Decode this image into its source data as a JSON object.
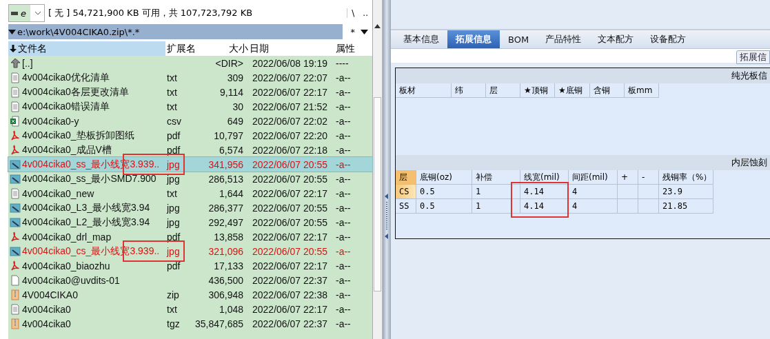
{
  "file_panel": {
    "drive": {
      "letter": "e"
    },
    "free_space": "[ 无 ]  54,721,900 KB 可用，共 107,723,792 KB",
    "nav_buttons": [
      "\\",
      ".."
    ],
    "path": "e:\\work\\4V004CIKA0.zip\\*.*",
    "filter": "*",
    "columns": [
      {
        "label": "文件名",
        "sorted": true
      },
      {
        "label": "扩展名",
        "sorted": false
      },
      {
        "label": "大小",
        "sorted": false
      },
      {
        "label": "日期",
        "sorted": false
      },
      {
        "label": "属性",
        "sorted": false
      }
    ],
    "rows": [
      {
        "kind": "up",
        "name": "[..]",
        "ext": "",
        "size": "<DIR>",
        "date": "2022/06/08 19:19",
        "attr": "----",
        "selected": false,
        "marked": false,
        "annotated": false
      },
      {
        "kind": "text",
        "name": "4v004cika0优化清单",
        "ext": "txt",
        "size": "309",
        "date": "2022/06/07 22:07",
        "attr": "-a--",
        "selected": false,
        "marked": false,
        "annotated": false
      },
      {
        "kind": "text",
        "name": "4v004cika0各层更改清单",
        "ext": "txt",
        "size": "9,114",
        "date": "2022/06/07 22:17",
        "attr": "-a--",
        "selected": false,
        "marked": false,
        "annotated": false
      },
      {
        "kind": "text",
        "name": "4v004cika0错误清单",
        "ext": "txt",
        "size": "30",
        "date": "2022/06/07 21:52",
        "attr": "-a--",
        "selected": false,
        "marked": false,
        "annotated": false
      },
      {
        "kind": "sheet",
        "name": "4v004cika0-y",
        "ext": "csv",
        "size": "649",
        "date": "2022/06/07 22:02",
        "attr": "-a--",
        "selected": false,
        "marked": false,
        "annotated": false
      },
      {
        "kind": "pdf",
        "name": "4v004cika0_垫板拆卸图纸",
        "ext": "pdf",
        "size": "10,797",
        "date": "2022/06/07 22:20",
        "attr": "-a--",
        "selected": false,
        "marked": false,
        "annotated": false
      },
      {
        "kind": "pdf",
        "name": "4v004cika0_成品V槽",
        "ext": "pdf",
        "size": "6,574",
        "date": "2022/06/07 22:18",
        "attr": "-a--",
        "selected": false,
        "marked": false,
        "annotated": false
      },
      {
        "kind": "image",
        "name": "4v004cika0_ss_最小线宽3.939..",
        "ext": "jpg",
        "size": "341,956",
        "date": "2022/06/07 20:55",
        "attr": "-a--",
        "selected": true,
        "marked": true,
        "annotated": true
      },
      {
        "kind": "image",
        "name": "4v004cika0_ss_最小SMD7.900",
        "ext": "jpg",
        "size": "286,513",
        "date": "2022/06/07 20:55",
        "attr": "-a--",
        "selected": false,
        "marked": false,
        "annotated": false
      },
      {
        "kind": "text",
        "name": "4v004cika0_new",
        "ext": "txt",
        "size": "1,644",
        "date": "2022/06/07 22:17",
        "attr": "-a--",
        "selected": false,
        "marked": false,
        "annotated": false
      },
      {
        "kind": "image",
        "name": "4v004cika0_L3_最小线宽3.94",
        "ext": "jpg",
        "size": "286,377",
        "date": "2022/06/07 20:55",
        "attr": "-a--",
        "selected": false,
        "marked": false,
        "annotated": false
      },
      {
        "kind": "image",
        "name": "4v004cika0_L2_最小线宽3.94",
        "ext": "jpg",
        "size": "292,497",
        "date": "2022/06/07 20:55",
        "attr": "-a--",
        "selected": false,
        "marked": false,
        "annotated": false
      },
      {
        "kind": "pdf",
        "name": "4v004cika0_drl_map",
        "ext": "pdf",
        "size": "13,858",
        "date": "2022/06/07 22:17",
        "attr": "-a--",
        "selected": false,
        "marked": false,
        "annotated": false
      },
      {
        "kind": "image",
        "name": "4v004cika0_cs_最小线宽3.939..",
        "ext": "jpg",
        "size": "321,096",
        "date": "2022/06/07 20:55",
        "attr": "-a--",
        "selected": false,
        "marked": true,
        "annotated": true
      },
      {
        "kind": "pdf",
        "name": "4v004cika0_biaozhu",
        "ext": "pdf",
        "size": "17,133",
        "date": "2022/06/07 22:17",
        "attr": "-a--",
        "selected": false,
        "marked": false,
        "annotated": false
      },
      {
        "kind": "blank",
        "name": "4v004cika0@uvdits-01",
        "ext": "",
        "size": "436,500",
        "date": "2022/06/07 22:37",
        "attr": "-a--",
        "selected": false,
        "marked": false,
        "annotated": false
      },
      {
        "kind": "archive",
        "name": "4V004CIKA0",
        "ext": "zip",
        "size": "306,948",
        "date": "2022/06/07 22:38",
        "attr": "-a--",
        "selected": false,
        "marked": false,
        "annotated": false
      },
      {
        "kind": "text",
        "name": "4v004cika0",
        "ext": "txt",
        "size": "1,048",
        "date": "2022/06/07 22:17",
        "attr": "-a--",
        "selected": false,
        "marked": false,
        "annotated": false
      },
      {
        "kind": "archive",
        "name": "4v004cika0",
        "ext": "tgz",
        "size": "35,847,685",
        "date": "2022/06/07 22:37",
        "attr": "-a--",
        "selected": false,
        "marked": false,
        "annotated": false
      }
    ]
  },
  "detail_panel": {
    "tabs": [
      {
        "label": "基本信息",
        "selected": false
      },
      {
        "label": "拓展信息",
        "selected": true
      },
      {
        "label": "BOM",
        "selected": false
      },
      {
        "label": "产品特性",
        "selected": false
      },
      {
        "label": "文本配方",
        "selected": false
      },
      {
        "label": "设备配方",
        "selected": false
      }
    ],
    "side_button": "拓展信",
    "board_section": {
      "title": "纯光板信",
      "columns": [
        "板材",
        "纬",
        "层",
        "★顶铜",
        "★底铜",
        "含铜",
        "板mm"
      ]
    },
    "etch_section": {
      "title": "内层蚀刻",
      "columns": [
        {
          "label": "层",
          "annotated": false
        },
        {
          "label": "底铜(oz)",
          "annotated": false
        },
        {
          "label": "补偿",
          "annotated": false
        },
        {
          "label": "线宽(mil)",
          "annotated": true
        },
        {
          "label": "间距(mil)",
          "annotated": false
        },
        {
          "label": "+",
          "annotated": false
        },
        {
          "label": "-",
          "annotated": false
        },
        {
          "label": "残铜率（%）",
          "annotated": false
        }
      ],
      "rows": [
        {
          "cells": [
            "CS",
            "0.5",
            "1",
            "4.14",
            "4",
            "",
            "",
            "23.9"
          ],
          "selected": true
        },
        {
          "cells": [
            "SS",
            "0.5",
            "1",
            "4.14",
            "4",
            "",
            "",
            "21.85"
          ],
          "selected": false
        }
      ]
    }
  }
}
